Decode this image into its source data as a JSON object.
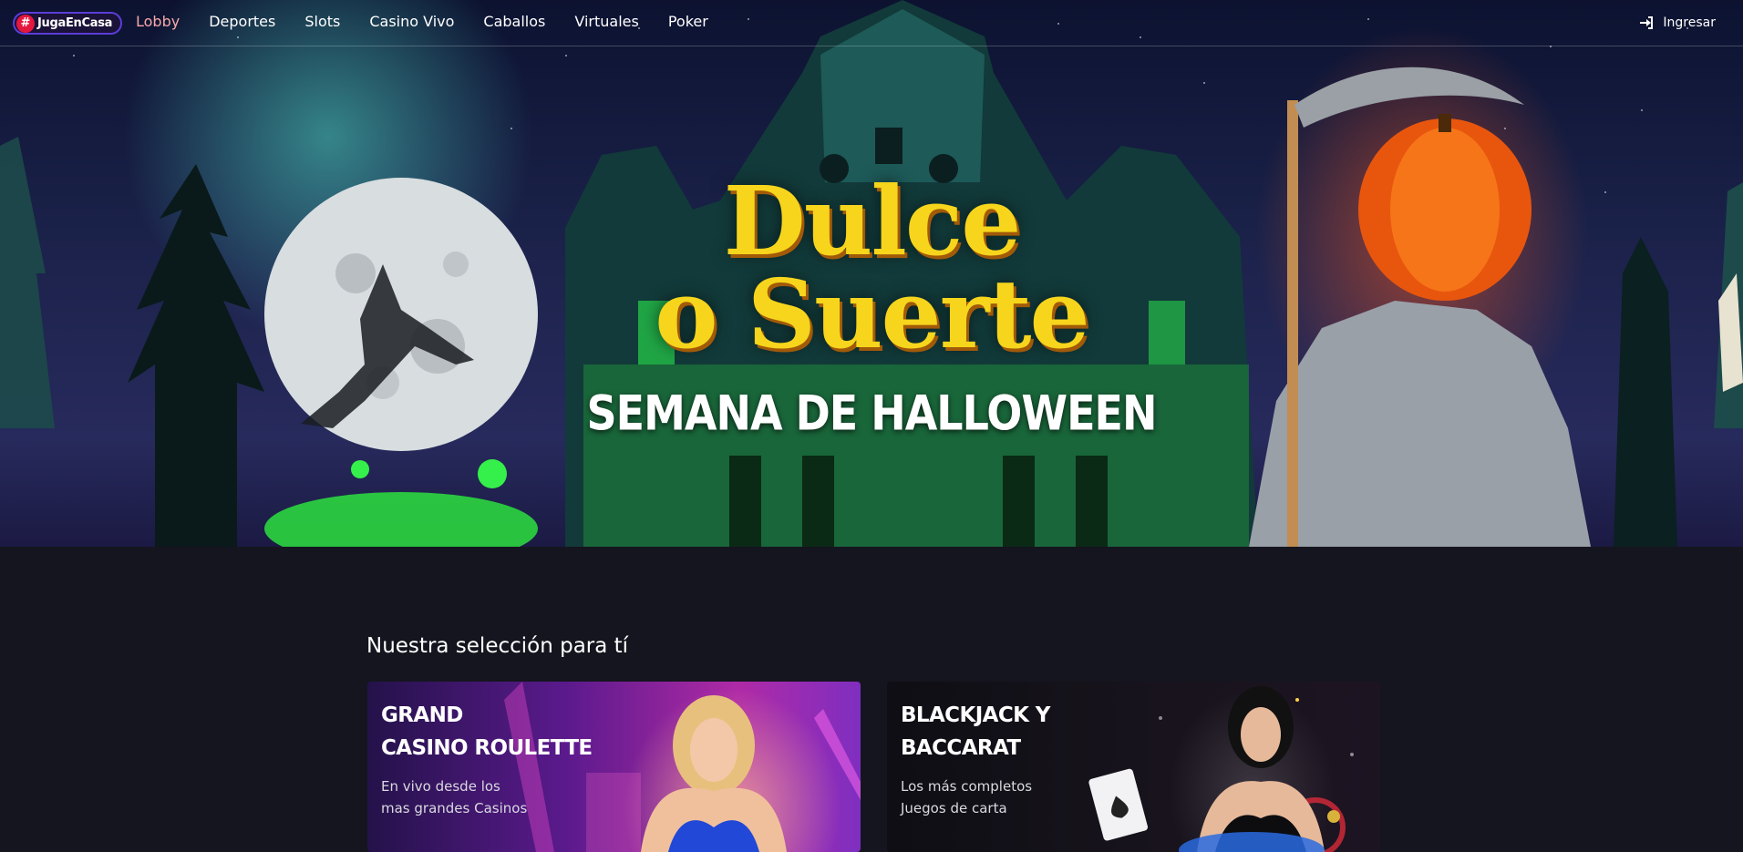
{
  "brand": {
    "hash": "#",
    "name": "JugaEnCasa"
  },
  "nav": {
    "items": [
      {
        "label": "Lobby",
        "active": true
      },
      {
        "label": "Deportes",
        "active": false
      },
      {
        "label": "Slots",
        "active": false
      },
      {
        "label": "Casino Vivo",
        "active": false
      },
      {
        "label": "Caballos",
        "active": false
      },
      {
        "label": "Virtuales",
        "active": false
      },
      {
        "label": "Poker",
        "active": false
      }
    ],
    "login_label": "Ingresar",
    "login_icon": "sign-in-icon"
  },
  "hero": {
    "title_line1": "Dulce",
    "title_line2": "o Suerte",
    "subtitle": "SEMANA DE HALLOWEEN"
  },
  "selection": {
    "title": "Nuestra selección para tí",
    "cards": [
      {
        "title_line1": "GRAND",
        "title_line2": "CASINO ROULETTE",
        "desc_line1": "En vivo desde los",
        "desc_line2": "mas grandes Casinos"
      },
      {
        "title_line1": "BLACKJACK Y",
        "title_line2": "BACCARAT",
        "desc_line1": "Los más completos",
        "desc_line2": "Juegos de carta"
      }
    ]
  },
  "colors": {
    "accent_active_nav": "#f5a8a8",
    "logo_border": "#5b3dd8",
    "logo_hash_bg": "#e5173f",
    "hero_title": "#f6d51c",
    "page_bg": "#15151f"
  }
}
